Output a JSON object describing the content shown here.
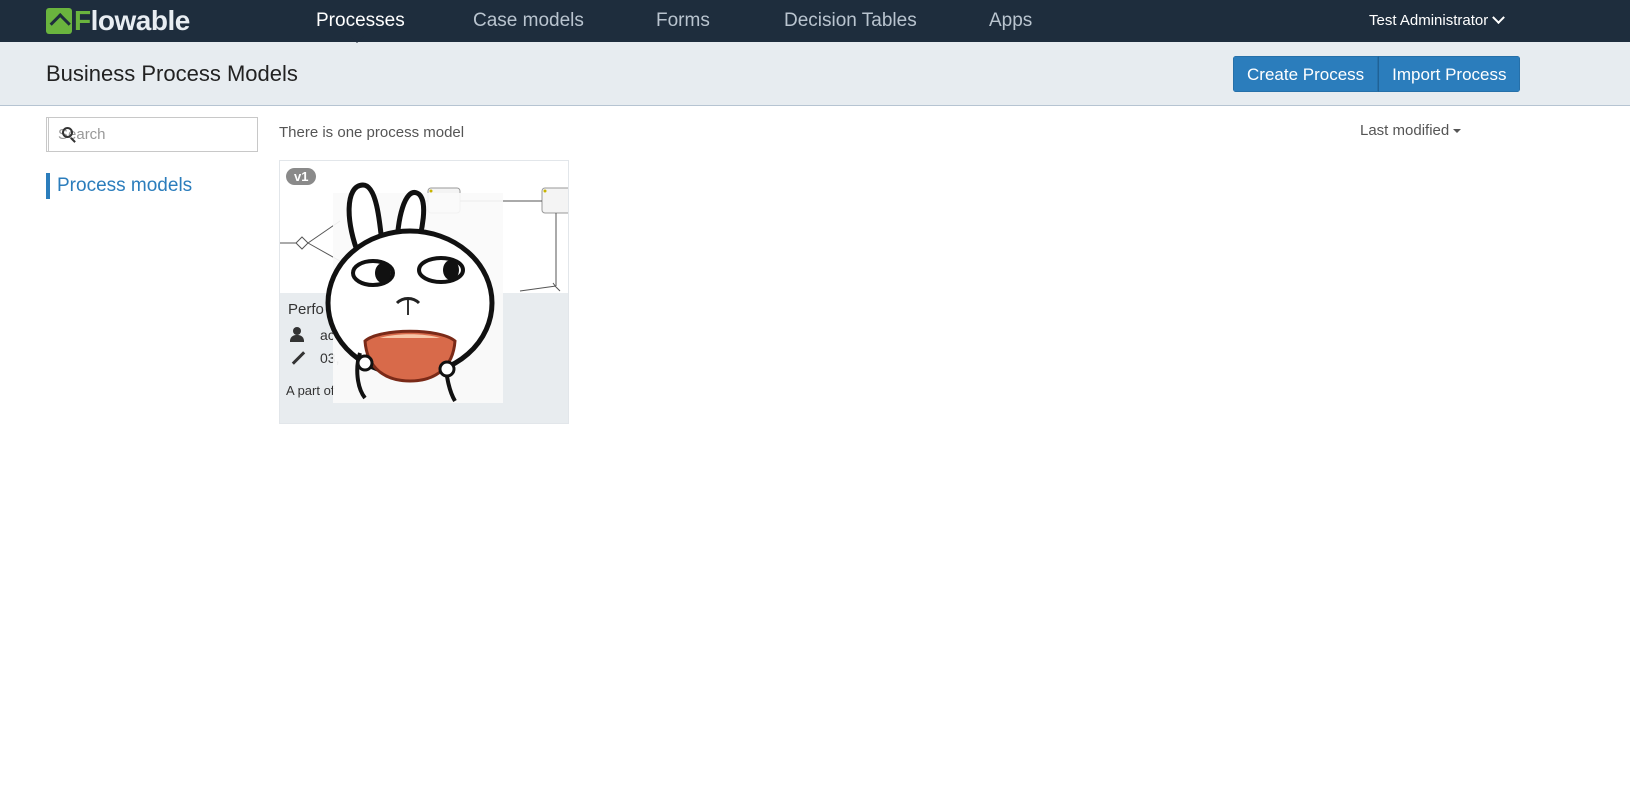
{
  "app": {
    "logo_text": "Flowable"
  },
  "nav": {
    "items": [
      {
        "label": "Processes",
        "active": true
      },
      {
        "label": "Case models",
        "active": false
      },
      {
        "label": "Forms",
        "active": false
      },
      {
        "label": "Decision Tables",
        "active": false
      },
      {
        "label": "Apps",
        "active": false
      }
    ],
    "user": "Test Administrator",
    "user_icon": "chevron-down-icon"
  },
  "header": {
    "title": "Business Process Models",
    "create_label": "Create Process",
    "import_label": "Import Process"
  },
  "sidebar": {
    "search_placeholder": "Search",
    "search_value": "",
    "items": [
      {
        "label": "Process models",
        "active": true
      }
    ]
  },
  "main": {
    "count_text": "There is one process model",
    "sort_label": "Last modified"
  },
  "cards": [
    {
      "version": "v1",
      "title": "Perfo",
      "owner": "ac",
      "modified": "03,",
      "description": "A part of"
    }
  ],
  "colors": {
    "nav_bg": "#1e2d3d",
    "brand_green": "#6ab43e",
    "accent": "#2b7dbc",
    "subheader_bg": "#e7ecf0"
  }
}
